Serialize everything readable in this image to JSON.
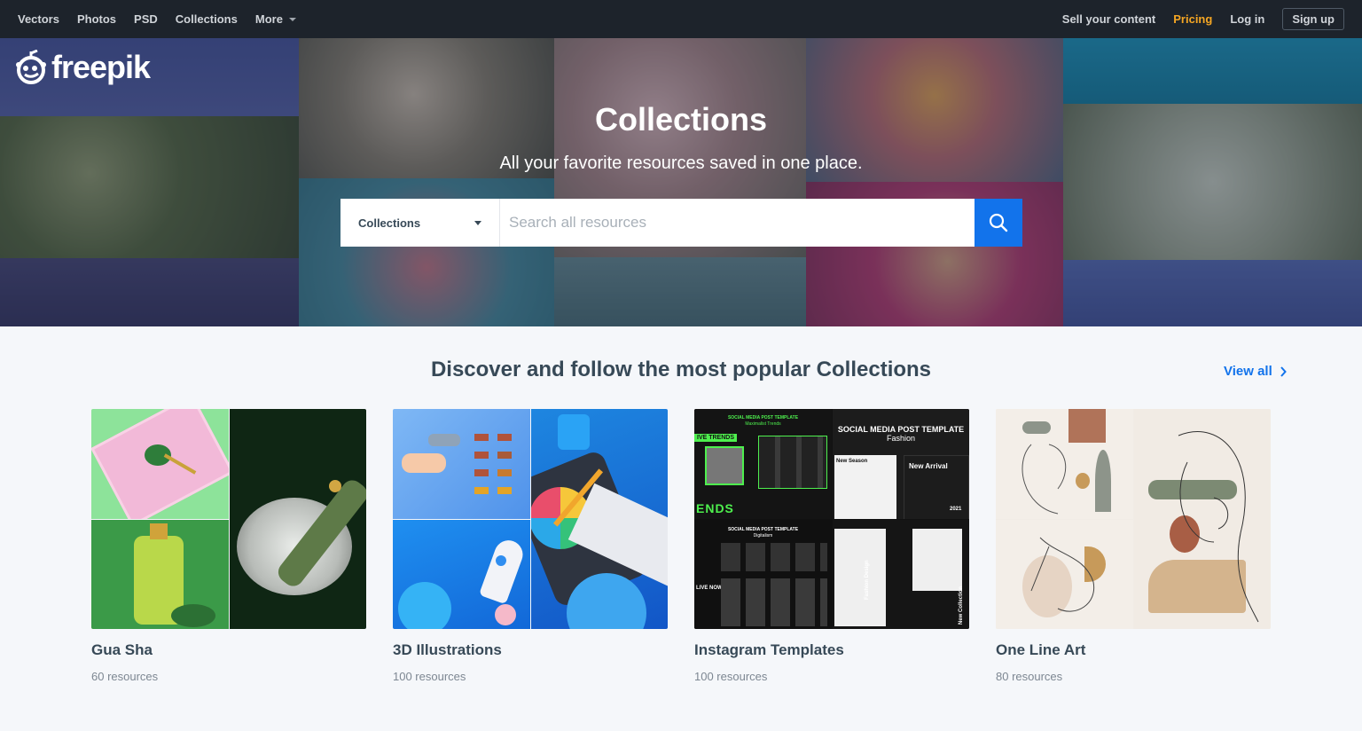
{
  "nav": {
    "left": [
      "Vectors",
      "Photos",
      "PSD",
      "Collections",
      "More"
    ],
    "sell": "Sell your content",
    "pricing": "Pricing",
    "login": "Log in",
    "signup": "Sign up"
  },
  "hero": {
    "logo_text": "freepik",
    "title": "Collections",
    "subtitle": "All your favorite resources saved in one place.",
    "search": {
      "category": "Collections",
      "placeholder": "Search all resources"
    }
  },
  "section": {
    "title": "Discover and follow the most popular Collections",
    "view_all": "View all"
  },
  "cards": [
    {
      "name": "Gua Sha",
      "count": "60 resources"
    },
    {
      "name": "3D Illustrations",
      "count": "100 resources"
    },
    {
      "name": "Instagram Templates",
      "count": "100 resources"
    },
    {
      "name": "One Line Art",
      "count": "80 resources"
    }
  ],
  "icons": {
    "logo": "freepik-logo-icon",
    "search": "search-icon",
    "view_all": "chevron-right-icon",
    "dropdown": "caret-down-icon"
  },
  "colors": {
    "nav_bg": "#1d232b",
    "accent": "#1273eb",
    "pricing": "#f5a623",
    "page_bg": "#f5f7fa"
  },
  "instagram_tile_text": {
    "top_left_title": "SOCIAL MEDIA POST TEMPLATE",
    "top_left_sub": "Maximalist Trends",
    "top_left_tag": "IVE TRENDS",
    "top_left_big": "ENDS",
    "top_right_title": "SOCIAL MEDIA POST TEMPLATE",
    "top_right_sub": "Fashion",
    "new_season": "New Season",
    "new_arrival": "New Arrival",
    "year": "2021",
    "bottom_left_title": "SOCIAL MEDIA POST TEMPLATE",
    "bottom_left_sub": "Digitalism",
    "live_now": "LIVE NOW",
    "fashion_design": "Fashion Design",
    "new_collection": "New Collection"
  }
}
